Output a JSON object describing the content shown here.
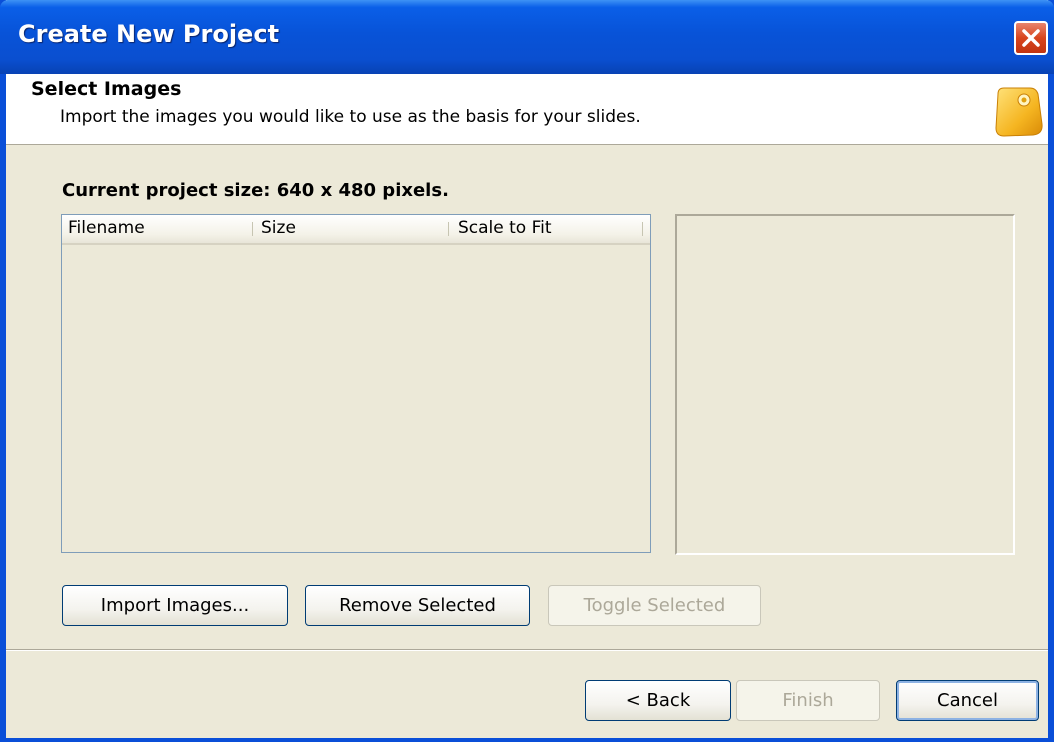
{
  "window": {
    "title": "Create New Project",
    "close_icon": "close-icon"
  },
  "header": {
    "title": "Select Images",
    "subtitle": "Import the images you would like to use as the basis for your slides.",
    "icon": "tag-icon"
  },
  "project": {
    "size_label": "Current project size: 640 x 480 pixels."
  },
  "image_list": {
    "columns": [
      "Filename",
      "Size",
      "Scale to Fit"
    ],
    "rows": []
  },
  "actions": {
    "import_label": "Import Images...",
    "remove_label": "Remove Selected",
    "toggle_label": "Toggle Selected"
  },
  "footer": {
    "back_label": "< Back",
    "finish_label": "Finish",
    "cancel_label": "Cancel"
  },
  "colors": {
    "titlebar": "#0a4fd0",
    "dialog_bg": "#ece9d8",
    "close_button": "#d8451e",
    "tag_icon": "#f2b31c"
  }
}
